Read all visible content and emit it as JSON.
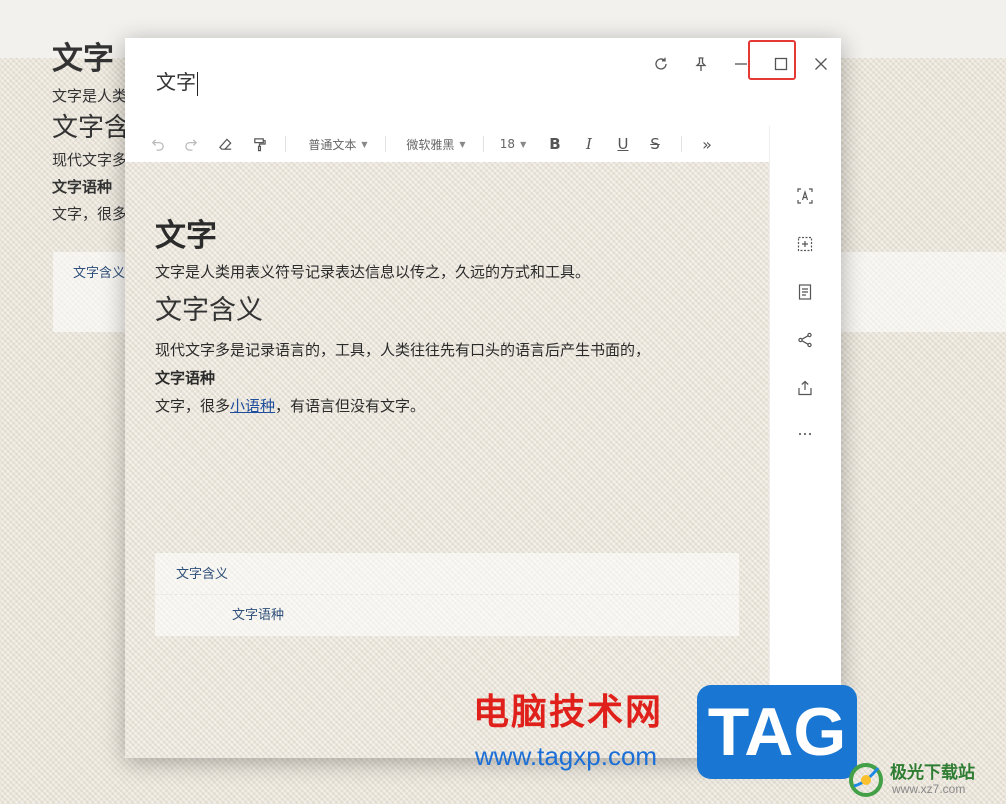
{
  "background_doc": {
    "title": "文字",
    "para1": "文字是人类",
    "h2": "文字含",
    "para2": "现代文字多",
    "bold": "文字语种",
    "para3": "文字，很多",
    "toc_item": "文字含义"
  },
  "window": {
    "title": "文字",
    "controls": {
      "refresh": "refresh-icon",
      "pin": "pin-icon",
      "minimize": "minimize-icon",
      "maximize": "maximize-icon",
      "close": "close-icon"
    },
    "highlight_color": "#e53935"
  },
  "toolbar": {
    "undo": "undo-icon",
    "redo": "redo-icon",
    "eraser": "eraser-icon",
    "format_painter": "format-painter-icon",
    "paragraph_style": "普通文本",
    "font_family": "微软雅黑",
    "font_size": "18",
    "bold": "B",
    "italic": "I",
    "underline": "U",
    "strike": "S",
    "more": "»"
  },
  "document": {
    "h1": "文字",
    "p1": "文字是人类用表义符号记录表达信息以传之，久远的方式和工具。",
    "h2": "文字含义",
    "p2": "现代文字多是记录语言的，工具，人类往往先有口头的语言后产生书面的，",
    "bold_line": "文字语种",
    "p3_before": "文字，很多",
    "p3_link": "小语种",
    "p3_after": "，有语言但没有文字。",
    "toc": [
      {
        "label": "文字含义",
        "level": 1
      },
      {
        "label": "文字语种",
        "level": 2
      }
    ]
  },
  "right_panel": [
    "text-box-icon",
    "add-frame-icon",
    "document-icon",
    "share-icon",
    "export-icon",
    "more-icon"
  ],
  "watermark": {
    "cn": "电脑技术网",
    "url": "www.tagxp.com",
    "tag": "TAG",
    "brand_cn": "极光下载站",
    "brand_url": "www.xz7.com"
  }
}
